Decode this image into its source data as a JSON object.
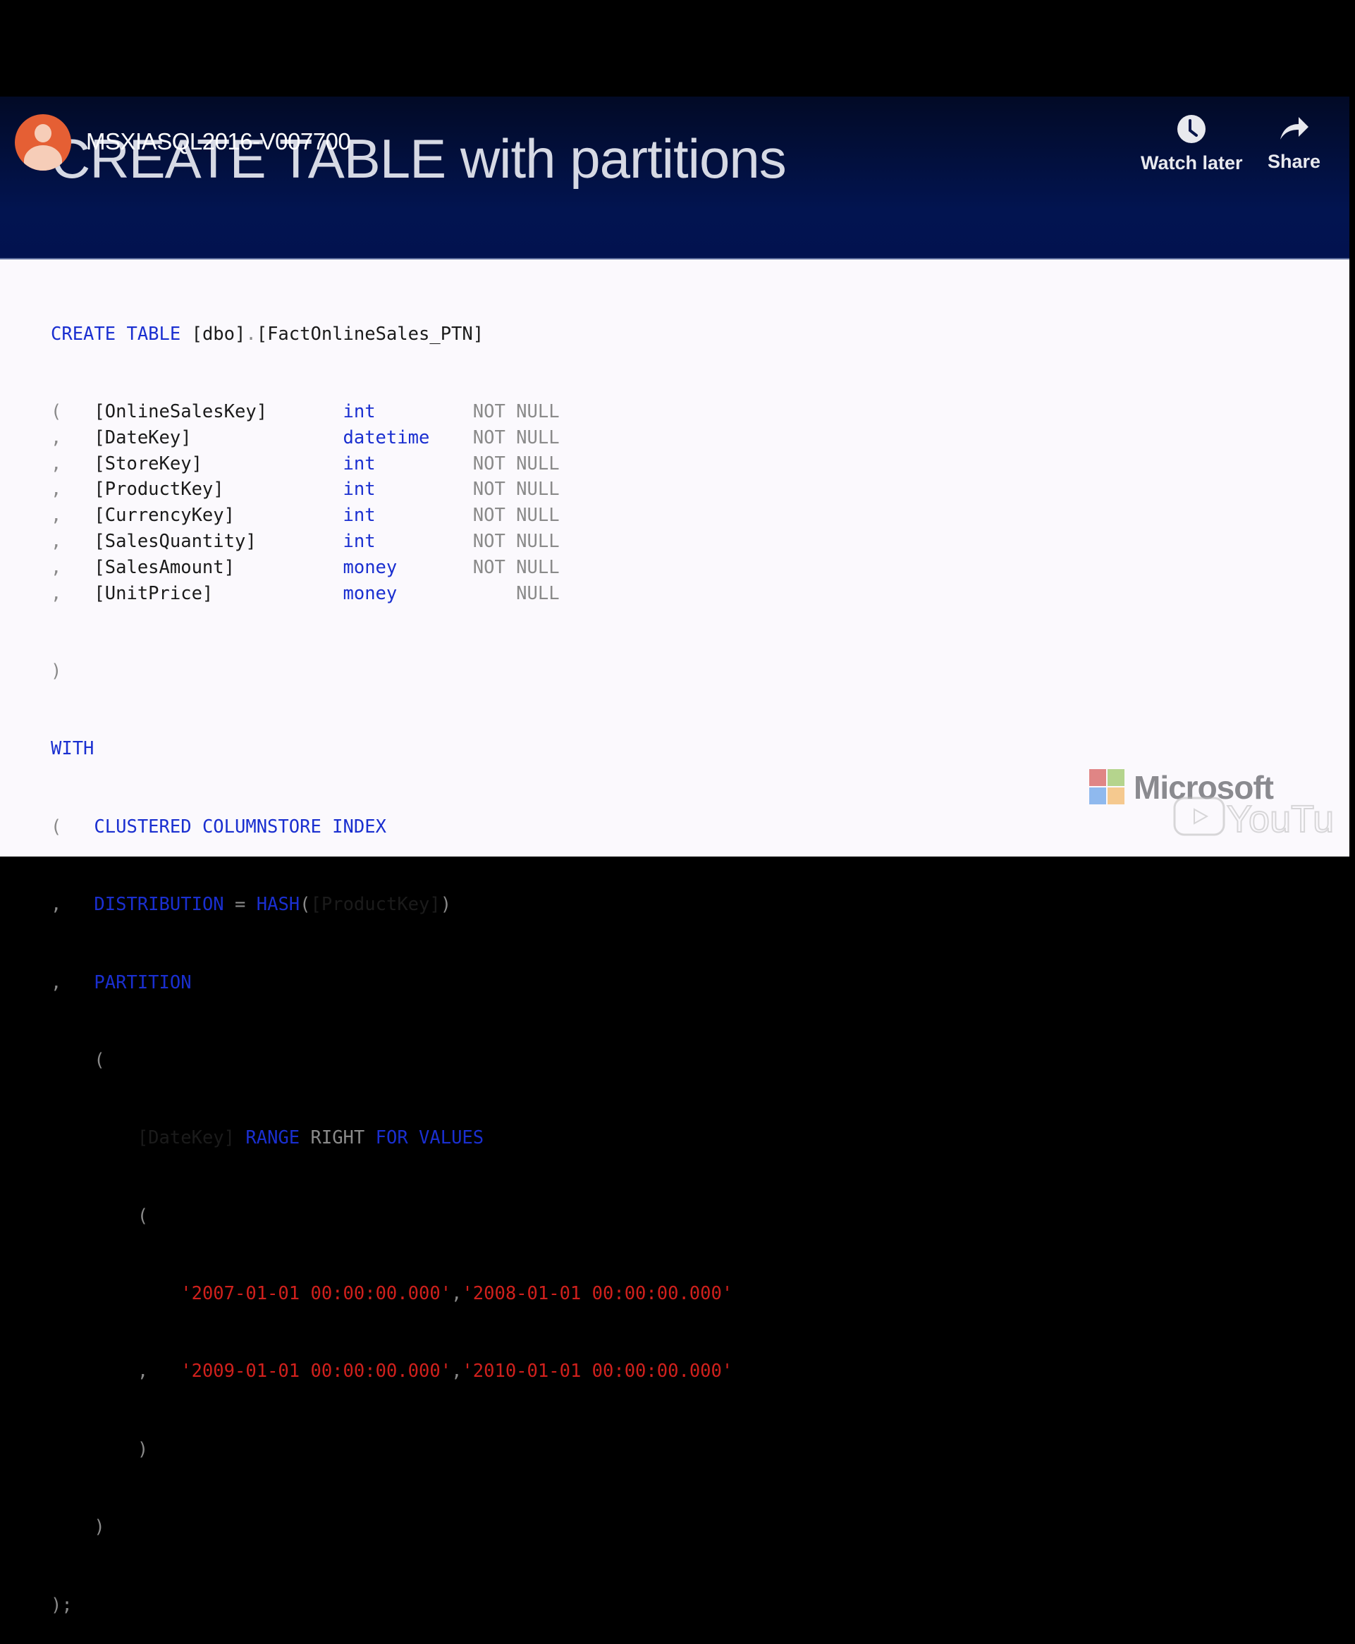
{
  "video": {
    "channel_name": "MSXIASQL2016-V007700",
    "watch_later_label": "Watch later",
    "share_label": "Share"
  },
  "slide": {
    "title": "CREATE TABLE with partitions",
    "logo_text": "Microsoft",
    "watermark_text": "YouTube"
  },
  "code": {
    "create_kw": "CREATE TABLE",
    "schema": "[dbo]",
    "dot": ".",
    "table": "[FactOnlineSales_PTN]",
    "columns": [
      {
        "lead": "(",
        "name": "[OnlineSalesKey]",
        "type": "int",
        "nullability": "NOT NULL"
      },
      {
        "lead": ",",
        "name": "[DateKey]",
        "type": "datetime",
        "nullability": "NOT NULL"
      },
      {
        "lead": ",",
        "name": "[StoreKey]",
        "type": "int",
        "nullability": "NOT NULL"
      },
      {
        "lead": ",",
        "name": "[ProductKey]",
        "type": "int",
        "nullability": "NOT NULL"
      },
      {
        "lead": ",",
        "name": "[CurrencyKey]",
        "type": "int",
        "nullability": "NOT NULL"
      },
      {
        "lead": ",",
        "name": "[SalesQuantity]",
        "type": "int",
        "nullability": "NOT NULL"
      },
      {
        "lead": ",",
        "name": "[SalesAmount]",
        "type": "money",
        "nullability": "NOT NULL"
      },
      {
        "lead": ",",
        "name": "[UnitPrice]",
        "type": "money",
        "nullability": "NULL"
      }
    ],
    "close_paren": ")",
    "open_paren": "(",
    "comma": ",",
    "with_kw": "WITH",
    "index_kw": "CLUSTERED COLUMNSTORE INDEX",
    "distribution_kw": "DISTRIBUTION",
    "equals": "=",
    "hash_kw": "HASH",
    "hash_col": "[ProductKey]",
    "partition_kw": "PARTITION",
    "partition_col": "[DateKey]",
    "range_kw": "RANGE",
    "right_kw": "RIGHT",
    "for_values_kw": "FOR VALUES",
    "values": [
      "'2007-01-01 00:00:00.000'",
      "'2008-01-01 00:00:00.000'",
      "'2009-01-01 00:00:00.000'",
      "'2010-01-01 00:00:00.000'"
    ],
    "end": ");"
  },
  "colors": {
    "keyword": "#1a2fd0",
    "string": "#d0201c",
    "operator": "#8a8a8a",
    "header_bg": "#02124f"
  }
}
